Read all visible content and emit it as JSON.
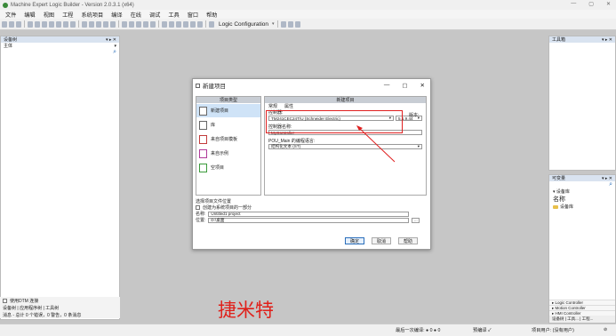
{
  "window": {
    "title": "Machine Expert Logic Builder - Version 2.0.3.1 (x64)",
    "controls": [
      "—",
      "▢",
      "✕"
    ]
  },
  "menu": [
    "文件",
    "编辑",
    "视图",
    "工程",
    "系统项目",
    "编译",
    "在线",
    "调试",
    "工具",
    "窗口",
    "帮助"
  ],
  "toolbar": {
    "config_label": "Logic Configuration",
    "dropdown_glyph": "▾"
  },
  "left_panel": {
    "title": "设备树",
    "pin_glyphs": "▾ ▸ ✕",
    "sub_label": "主体",
    "sub_dropdown": "▾",
    "search_icon": "⌕"
  },
  "left_bottom": {
    "checkbox_label": "使用DTM 连接",
    "tabs": "设备树 | 应用程序树 | 工具树",
    "status_row": "消息 - 总计 0 个错误，0 警告，0 条消息"
  },
  "right_panel_top": {
    "title": "工具箱",
    "pin_glyphs": "▾ ▸ ✕"
  },
  "right_panel_bot": {
    "title": "可变量",
    "pin_glyphs": "▾ ▸ ✕",
    "search_icon": "⌕",
    "section": "▾ 设备库",
    "big_label": "名称",
    "folder_label": "设备库",
    "foot_items": [
      "▸ Logic Controller",
      "▸ Motion Controller",
      "▸ HMI Controller"
    ],
    "footbar": "设备树 | 工具... | 工程..."
  },
  "statusbar": {
    "left_text": "最后一次编译: ● 0 ● 0",
    "mid_text": "预编译 ✓",
    "right_text": "项目用户: (没有用户)",
    "icon": "⊘"
  },
  "watermark": "捷米特",
  "dialog": {
    "title": "新建项目",
    "controls": [
      "—",
      "▢",
      "✕"
    ],
    "category_header": "项目类型",
    "categories": [
      "新建项目",
      "库",
      "来自项目模板",
      "来自示例",
      "空项目"
    ],
    "template_header": "新建项目",
    "tabs": [
      "常规",
      "属性"
    ],
    "controller_label": "控制器:",
    "controller_value": "TM241CEC24T/U (Schneider Electric)",
    "version_label": "版本:",
    "version_value": "5.1.9.44",
    "controller_name_label": "控制器名称:",
    "controller_name_value": "MyController",
    "lang_label": "POU_Main 的编程语言:",
    "lang_value": "结构化文本 (ST)",
    "location_header": "选择项目文件位置",
    "location_checkbox": "创建为系统项目的一部分",
    "name_label": "名称:",
    "name_value": "Untitled1 project",
    "loc_label": "位置:",
    "loc_value": "D:\\桌面",
    "browse": "...",
    "ok": "确定",
    "cancel": "取消",
    "help": "帮助"
  }
}
